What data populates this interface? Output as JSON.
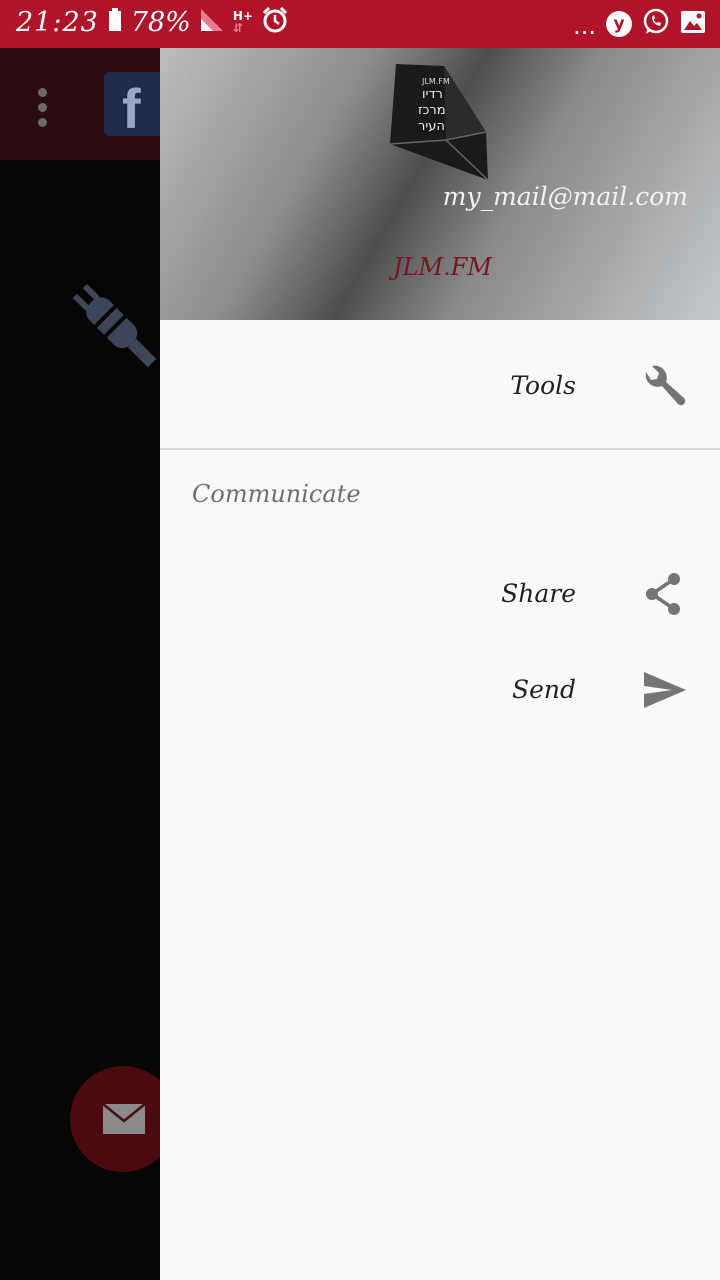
{
  "status_bar": {
    "time": "21:23",
    "battery_pct": "78%",
    "network": "H+",
    "overflow": "...",
    "app_badge": "y",
    "icons": [
      "battery-icon",
      "signal-icon",
      "alarm-icon",
      "yandex-icon",
      "whatsapp-icon",
      "gallery-icon"
    ]
  },
  "background_app": {
    "icons": [
      "overflow-menu-icon",
      "facebook-icon",
      "plug-icon",
      "mail-icon"
    ]
  },
  "drawer": {
    "header": {
      "logo_text": [
        "JLM.FM",
        "רדיו",
        "מרכז",
        "העיר"
      ],
      "email": "my_mail@mail.com",
      "brand": "JLM.FM"
    },
    "items": [
      {
        "label": "Tools",
        "icon": "wrench-icon"
      }
    ],
    "section_title": "Communicate",
    "section_items": [
      {
        "label": "Share",
        "icon": "share-icon"
      },
      {
        "label": "Send",
        "icon": "send-icon"
      }
    ]
  },
  "colors": {
    "status_bar": "#b0142a",
    "brand_text": "#7a1520",
    "drawer_bg": "#f9f9f9",
    "icon_grey": "#757575"
  }
}
